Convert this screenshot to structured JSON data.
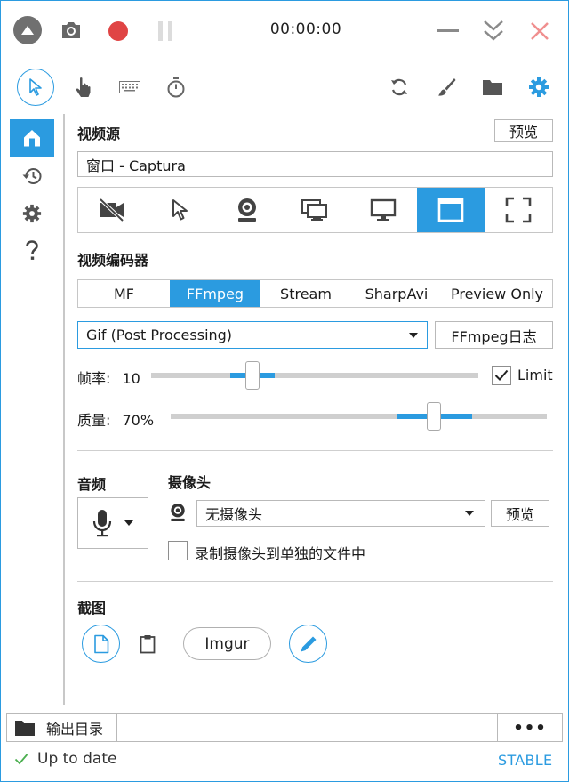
{
  "window": {
    "timer": "00:00:00"
  },
  "video_source": {
    "heading": "视频源",
    "preview_label": "预览",
    "selected": "窗口 - Captura",
    "active_index": 5
  },
  "video_encoder": {
    "heading": "视频编码器",
    "tabs": [
      "MF",
      "FFmpeg",
      "Stream",
      "SharpAvi",
      "Preview Only"
    ],
    "active_tab": "FFmpeg",
    "codec": "Gif (Post Processing)",
    "log_label": "FFmpeg日志"
  },
  "framerate": {
    "label": "帧率:",
    "value": "10",
    "fraction": 0.31,
    "limit_label": "Limit",
    "limit_checked": true
  },
  "quality": {
    "label": "质量:",
    "value": "70%",
    "fraction": 0.7
  },
  "audio": {
    "heading": "音频"
  },
  "webcam": {
    "heading": "摄像头",
    "selected": "无摄像头",
    "preview_label": "预览",
    "separate_file_label": "录制摄像头到单独的文件中",
    "separate_file_checked": false
  },
  "screenshot": {
    "heading": "截图",
    "imgur_label": "Imgur"
  },
  "output": {
    "folder_label": "输出目录",
    "path": "",
    "more_label": "•••"
  },
  "status": {
    "text": "Up to date",
    "channel": "STABLE"
  },
  "colors": {
    "accent": "#2b9be0",
    "record": "#e04444",
    "close": "#f08f8f",
    "status_ok": "#4caf50"
  }
}
